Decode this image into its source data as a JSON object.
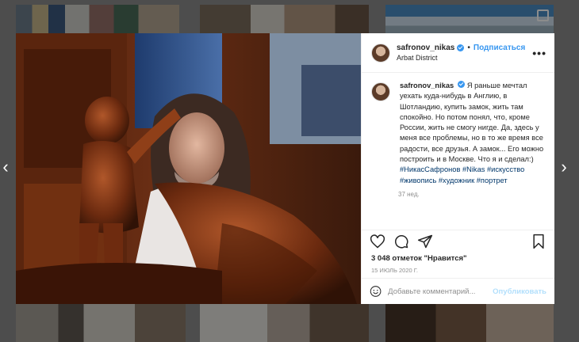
{
  "post": {
    "username": "safronov_nikas",
    "separator": "•",
    "follow_label": "Подписаться",
    "location": "Arbat District",
    "more_icon": "more-options-icon",
    "caption_text": "Я раньше мечтал уехать куда-нибудь в Англию, в Шотландию, купить замок, жить там спокойно. Но потом понял, что, кроме России, жить не смогу нигде. Да, здесь у меня все проблемы, но в то же время все радости, все друзья. А замок... Его можно построить и в Москве. Что я и сделал:)",
    "hashtags": "#НикасСафронов #Nikas #искусство #живопись #художник #портрет",
    "time_ago": "37 нед.",
    "likes": "3 048 отметок \"Нравится\"",
    "date": "15 июль 2020 г.",
    "comment_placeholder": "Добавьте комментарий...",
    "publish_label": "Опубликовать"
  },
  "colors": {
    "accent": "#3897f0",
    "publish_disabled": "#b2dffc",
    "muted": "#8e8e8e"
  },
  "icons": [
    "heart-icon",
    "comment-icon",
    "share-icon",
    "bookmark-icon",
    "emoji-icon",
    "chevron-left-icon",
    "chevron-right-icon"
  ]
}
